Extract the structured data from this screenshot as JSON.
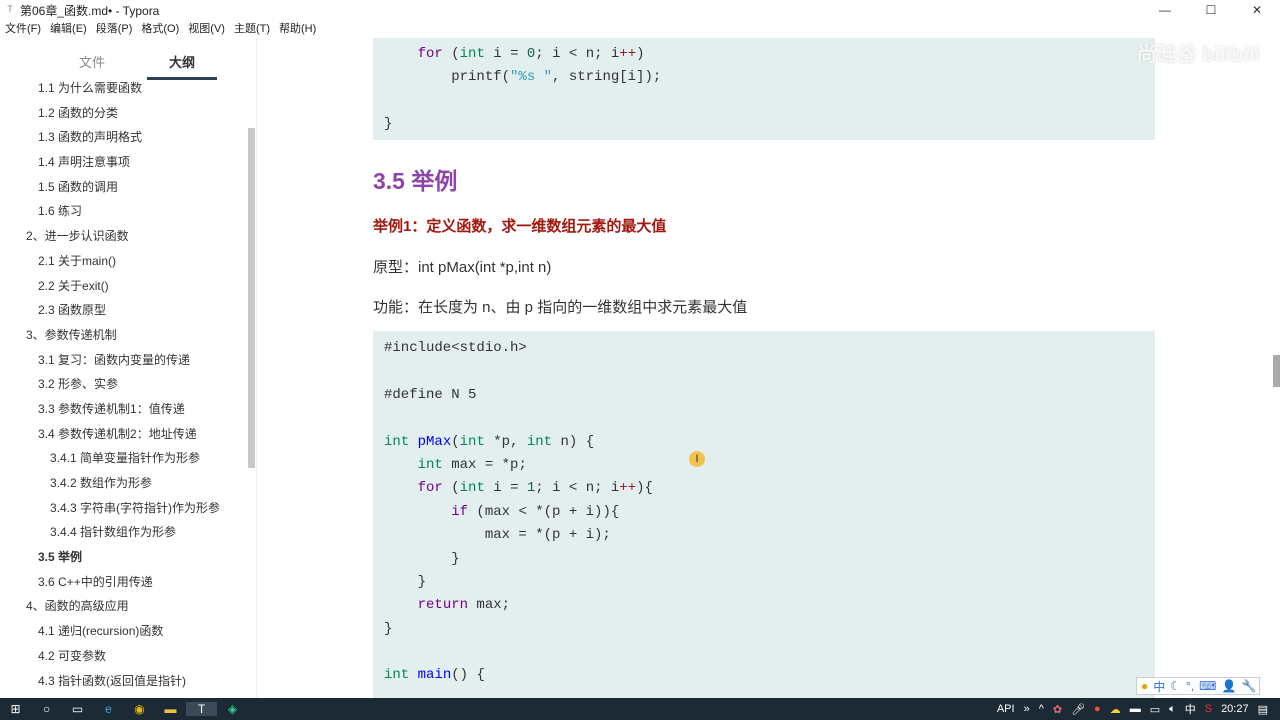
{
  "window": {
    "title": "第06章_函数.md• - Typora",
    "minimize": "—",
    "maximize": "☐",
    "close": "✕"
  },
  "menu": [
    "文件(F)",
    "编辑(E)",
    "段落(P)",
    "格式(O)",
    "视图(V)",
    "主题(T)",
    "帮助(H)"
  ],
  "sidebar": {
    "tabs": [
      "文件",
      "大纲"
    ],
    "active_tab": "大纲",
    "outline": [
      {
        "t": "1.1 为什么需要函数",
        "l": 2
      },
      {
        "t": "1.2 函数的分类",
        "l": 2
      },
      {
        "t": "1.3 函数的声明格式",
        "l": 2
      },
      {
        "t": "1.4 声明注意事项",
        "l": 2
      },
      {
        "t": "1.5 函数的调用",
        "l": 2
      },
      {
        "t": "1.6 练习",
        "l": 2
      },
      {
        "t": "2、进一步认识函数",
        "l": 1
      },
      {
        "t": "2.1 关于main()",
        "l": 2
      },
      {
        "t": "2.2 关于exit()",
        "l": 2
      },
      {
        "t": "2.3 函数原型",
        "l": 2
      },
      {
        "t": "3、参数传递机制",
        "l": 1
      },
      {
        "t": "3.1 复习：函数内变量的传递",
        "l": 2
      },
      {
        "t": "3.2 形参、实参",
        "l": 2
      },
      {
        "t": "3.3 参数传递机制1：值传递",
        "l": 2
      },
      {
        "t": "3.4 参数传递机制2：地址传递",
        "l": 2
      },
      {
        "t": "3.4.1 简单变量指针作为形参",
        "l": 3
      },
      {
        "t": "3.4.2 数组作为形参",
        "l": 3
      },
      {
        "t": "3.4.3 字符串(字符指针)作为形参",
        "l": 3
      },
      {
        "t": "3.4.4 指针数组作为形参",
        "l": 3
      },
      {
        "t": "3.5 举例",
        "l": 2,
        "current": true
      },
      {
        "t": "3.6 C++中的引用传递",
        "l": 2
      },
      {
        "t": "4、函数的高级应用",
        "l": 1
      },
      {
        "t": "4.1 递归(recursion)函数",
        "l": 2
      },
      {
        "t": "4.2 可变参数",
        "l": 2
      },
      {
        "t": "4.3 指针函数(返回值是指针)",
        "l": 2
      }
    ],
    "footer": [
      "<",
      "</>"
    ]
  },
  "content": {
    "code1": [
      [
        [
          "    ",
          ""
        ],
        [
          "for",
          "kw"
        ],
        [
          " (",
          ""
        ],
        [
          "int",
          "ty"
        ],
        [
          " i = ",
          ""
        ],
        [
          "0",
          "nu"
        ],
        [
          "; i < n; i",
          ""
        ],
        [
          "++",
          "op"
        ],
        [
          ")",
          ""
        ]
      ],
      [
        [
          "        printf(",
          ""
        ],
        [
          "\"%s \"",
          "st"
        ],
        [
          ", string[i]);",
          ""
        ]
      ],
      [
        [
          "",
          ""
        ]
      ],
      [
        [
          "}",
          ""
        ]
      ]
    ],
    "heading": "3.5 举例",
    "example_title": "举例1：定义函数，求一维数组元素的最大值",
    "prototype": "原型：int pMax(int *p,int n)",
    "function": "功能：在长度为 n、由 p 指向的一维数组中求元素最大值",
    "code2": [
      [
        [
          "#include<stdio.h>",
          ""
        ]
      ],
      [
        [
          "",
          ""
        ]
      ],
      [
        [
          "#define N 5",
          ""
        ]
      ],
      [
        [
          "",
          ""
        ]
      ],
      [
        [
          "int",
          "ty"
        ],
        [
          " ",
          ""
        ],
        [
          "pMax",
          "fn"
        ],
        [
          "(",
          ""
        ],
        [
          "int",
          "ty"
        ],
        [
          " *p, ",
          ""
        ],
        [
          "int",
          "ty"
        ],
        [
          " n) {",
          ""
        ]
      ],
      [
        [
          "    ",
          ""
        ],
        [
          "int",
          "ty"
        ],
        [
          " max = *p;",
          ""
        ]
      ],
      [
        [
          "    ",
          ""
        ],
        [
          "for",
          "kw"
        ],
        [
          " (",
          ""
        ],
        [
          "int",
          "ty"
        ],
        [
          " i = ",
          ""
        ],
        [
          "1",
          "nu"
        ],
        [
          "; i < n; i",
          ""
        ],
        [
          "++",
          "op"
        ],
        [
          "){",
          ""
        ]
      ],
      [
        [
          "        ",
          ""
        ],
        [
          "if",
          "kw"
        ],
        [
          " (max < *(p + i)){",
          ""
        ]
      ],
      [
        [
          "            max = *(p + i);",
          ""
        ]
      ],
      [
        [
          "        }",
          ""
        ]
      ],
      [
        [
          "    }",
          ""
        ]
      ],
      [
        [
          "    ",
          ""
        ],
        [
          "return",
          "kw"
        ],
        [
          " max;",
          ""
        ]
      ],
      [
        [
          "}",
          ""
        ]
      ],
      [
        [
          "",
          ""
        ]
      ],
      [
        [
          "int",
          "ty"
        ],
        [
          " ",
          ""
        ],
        [
          "main",
          "fn"
        ],
        [
          "() {",
          ""
        ]
      ]
    ],
    "watermark": "尚硅谷 bilibili"
  },
  "ime": [
    "中",
    "☾",
    "°,",
    "⌨",
    "👤",
    "🔧"
  ],
  "taskbar": {
    "tray": [
      "API",
      "»",
      "^",
      "中"
    ],
    "time": "20:27"
  },
  "colors": {
    "heading": "#8e44ad",
    "example": "#a3180f",
    "code_bg": "#e3eeee"
  }
}
